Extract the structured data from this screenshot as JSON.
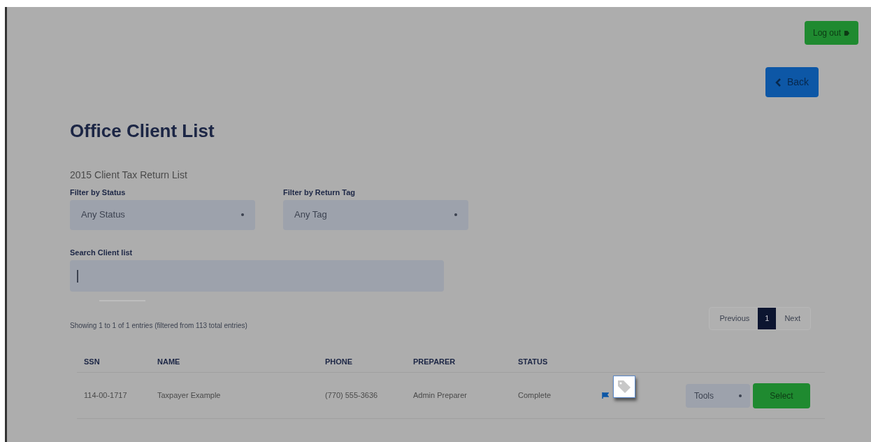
{
  "header": {
    "logout_button": "Log out",
    "back_button": "Back"
  },
  "title": "Office Client List",
  "subtitle": "2015 Client Tax Return List",
  "filters": [
    {
      "label": "Filter by Status",
      "value": "Any Status"
    },
    {
      "label": "Filter by Return Tag",
      "value": "Any Tag"
    }
  ],
  "search": {
    "label": "Search Client list"
  },
  "info": "Showing 1 to 1 of 1 entries (filtered from 113 total entries)",
  "pagination": {
    "previous": "Previous",
    "next": "Next",
    "pages": [
      {
        "label": "1",
        "selected": true
      }
    ]
  },
  "table": {
    "columns": [
      "SSN",
      "NAME",
      "PHONE",
      "PREPARER",
      "STATUS"
    ],
    "rows": [
      {
        "cells": [
          "114-00-1717",
          "Taxpayer Example",
          "(770) 555-3636",
          "Admin Preparer",
          "Complete"
        ],
        "flagged": true,
        "tools": "Tools",
        "select": "Select"
      }
    ]
  }
}
